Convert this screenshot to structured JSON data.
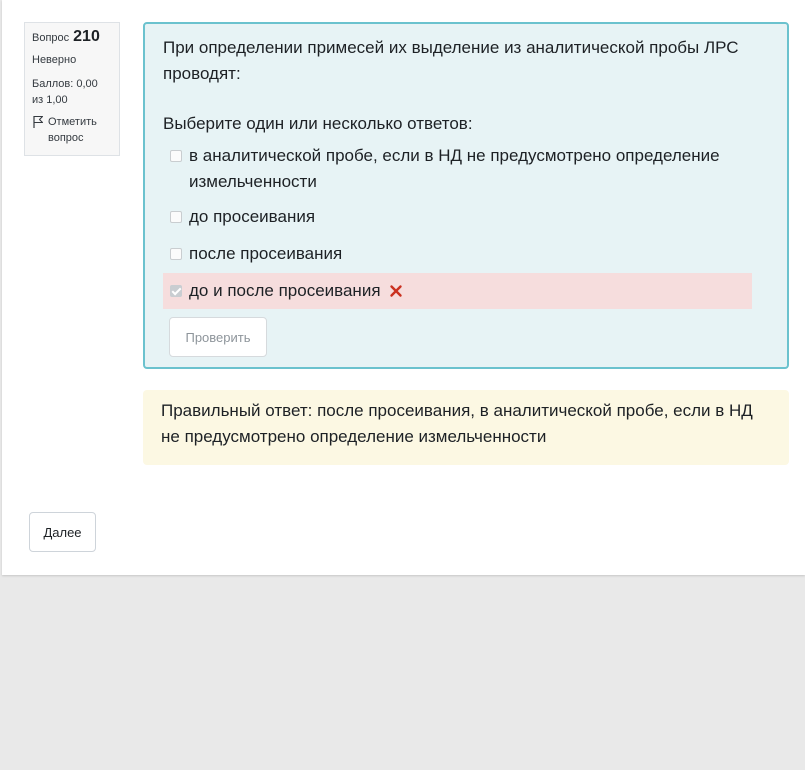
{
  "info": {
    "question_label": "Вопрос",
    "question_number": "210",
    "state": "Неверно",
    "grade": "Баллов: 0,00 из 1,00",
    "flag_label": "Отметить вопрос",
    "flag_icon": "flag-icon"
  },
  "question": {
    "text": "При определении примесей их выделение из аналитической пробы ЛРС проводят:",
    "prompt": "Выберите один или несколько ответов:",
    "answers": [
      {
        "label": "в аналитической пробе, если в НД не предусмотрено определение измельченности",
        "checked": false,
        "incorrect": false
      },
      {
        "label": "до просеивания",
        "checked": false,
        "incorrect": false
      },
      {
        "label": "после просеивания",
        "checked": false,
        "incorrect": false
      },
      {
        "label": "до и после просеивания",
        "checked": true,
        "incorrect": true
      }
    ],
    "incorrect_icon": "cross-icon",
    "check_button": "Проверить"
  },
  "feedback": {
    "right_answer": "Правильный ответ: после просеивания, в аналитической пробе, если в НД не предусмотрено определение измельченности"
  },
  "navigation": {
    "next_button": "Далее"
  },
  "colors": {
    "formulation_bg": "#e7f3f5",
    "formulation_border": "#6bc2ce",
    "incorrect_bg": "#f6dddd",
    "feedback_bg": "#fcf8e3",
    "cross": "#ca3120"
  }
}
